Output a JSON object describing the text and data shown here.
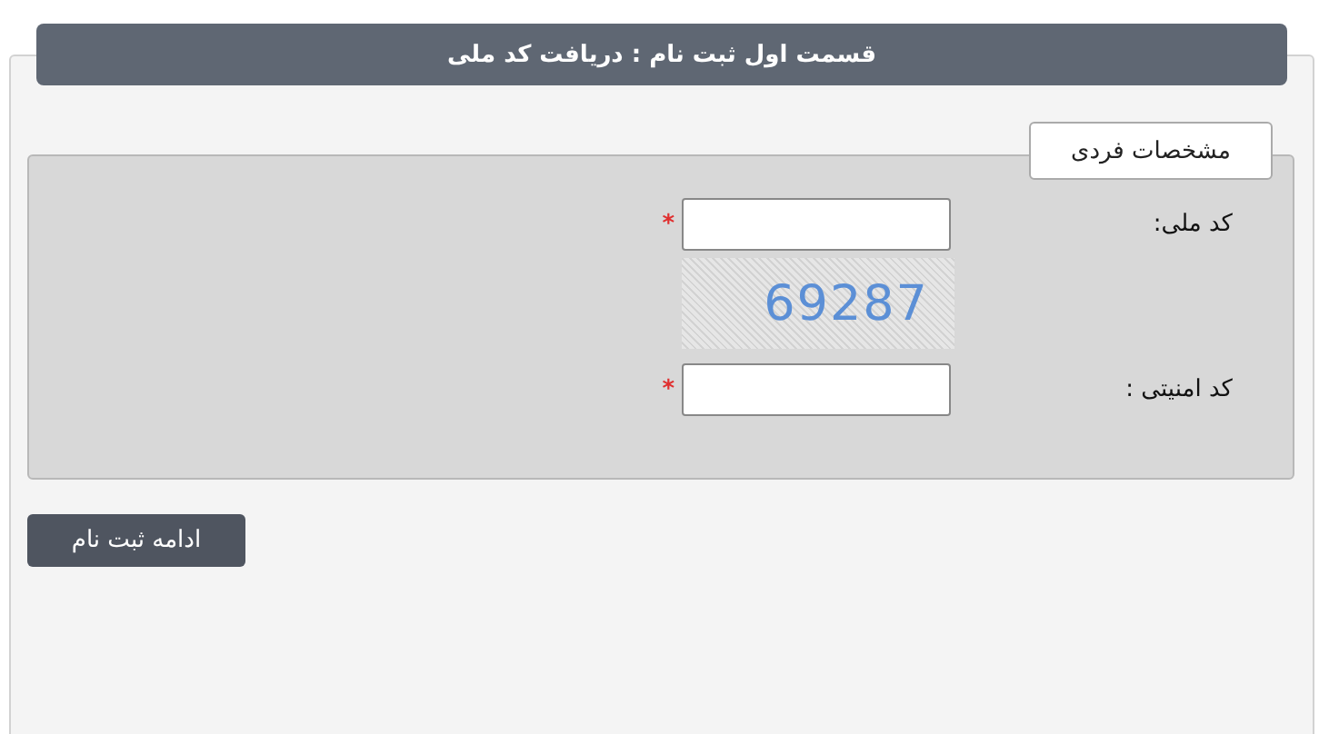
{
  "header": {
    "title": "قسمت اول ثبت نام : دریافت کد ملی"
  },
  "section": {
    "legend": "مشخصات فردی",
    "rows": [
      {
        "kind": "input",
        "label": "کد ملی:",
        "value": "",
        "required": true,
        "required_mark": "*"
      },
      {
        "kind": "captcha",
        "code": "69287"
      },
      {
        "kind": "input",
        "label": "کد امنیتی :",
        "value": "",
        "required": true,
        "required_mark": "*"
      }
    ]
  },
  "submit": {
    "label": "ادامه ثبت نام"
  }
}
